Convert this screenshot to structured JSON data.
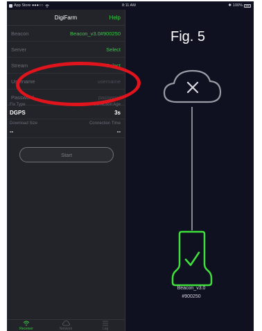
{
  "status_bar": {
    "carrier": "App Store ●●●○○",
    "time": "8:11 AM",
    "battery": "100%",
    "bluetooth_symbol": "✱"
  },
  "nav": {
    "title": "DigiFarm",
    "help": "Help"
  },
  "settings": [
    {
      "label": "Beacon",
      "value": "Beacon_v3.0#900250"
    },
    {
      "label": "Server",
      "value": "Select"
    },
    {
      "label": "Stream",
      "value": "Select"
    },
    {
      "label": "Username",
      "value": "username"
    },
    {
      "label": "Password",
      "value": "password"
    }
  ],
  "fix": {
    "type_label": "Fix Type",
    "type_value": "DGPS",
    "age_label": "Correction Age",
    "age_value": "3s"
  },
  "download": {
    "size_label": "Download Size",
    "size_value": "--",
    "time_label": "Connection Time",
    "time_value": "--"
  },
  "start_button": "Start",
  "tabs": [
    {
      "label": "Receiver",
      "icon": "wifi-icon"
    },
    {
      "label": "Network",
      "icon": "cloud-icon"
    },
    {
      "label": "Log",
      "icon": "list-icon"
    }
  ],
  "figure_label": "Fig. 5",
  "device": {
    "name": "Beacon_v3.0",
    "id": "#900250"
  },
  "colors": {
    "accent": "#3cc84a",
    "annotation": "#e0141c",
    "background": "#0f1020"
  }
}
